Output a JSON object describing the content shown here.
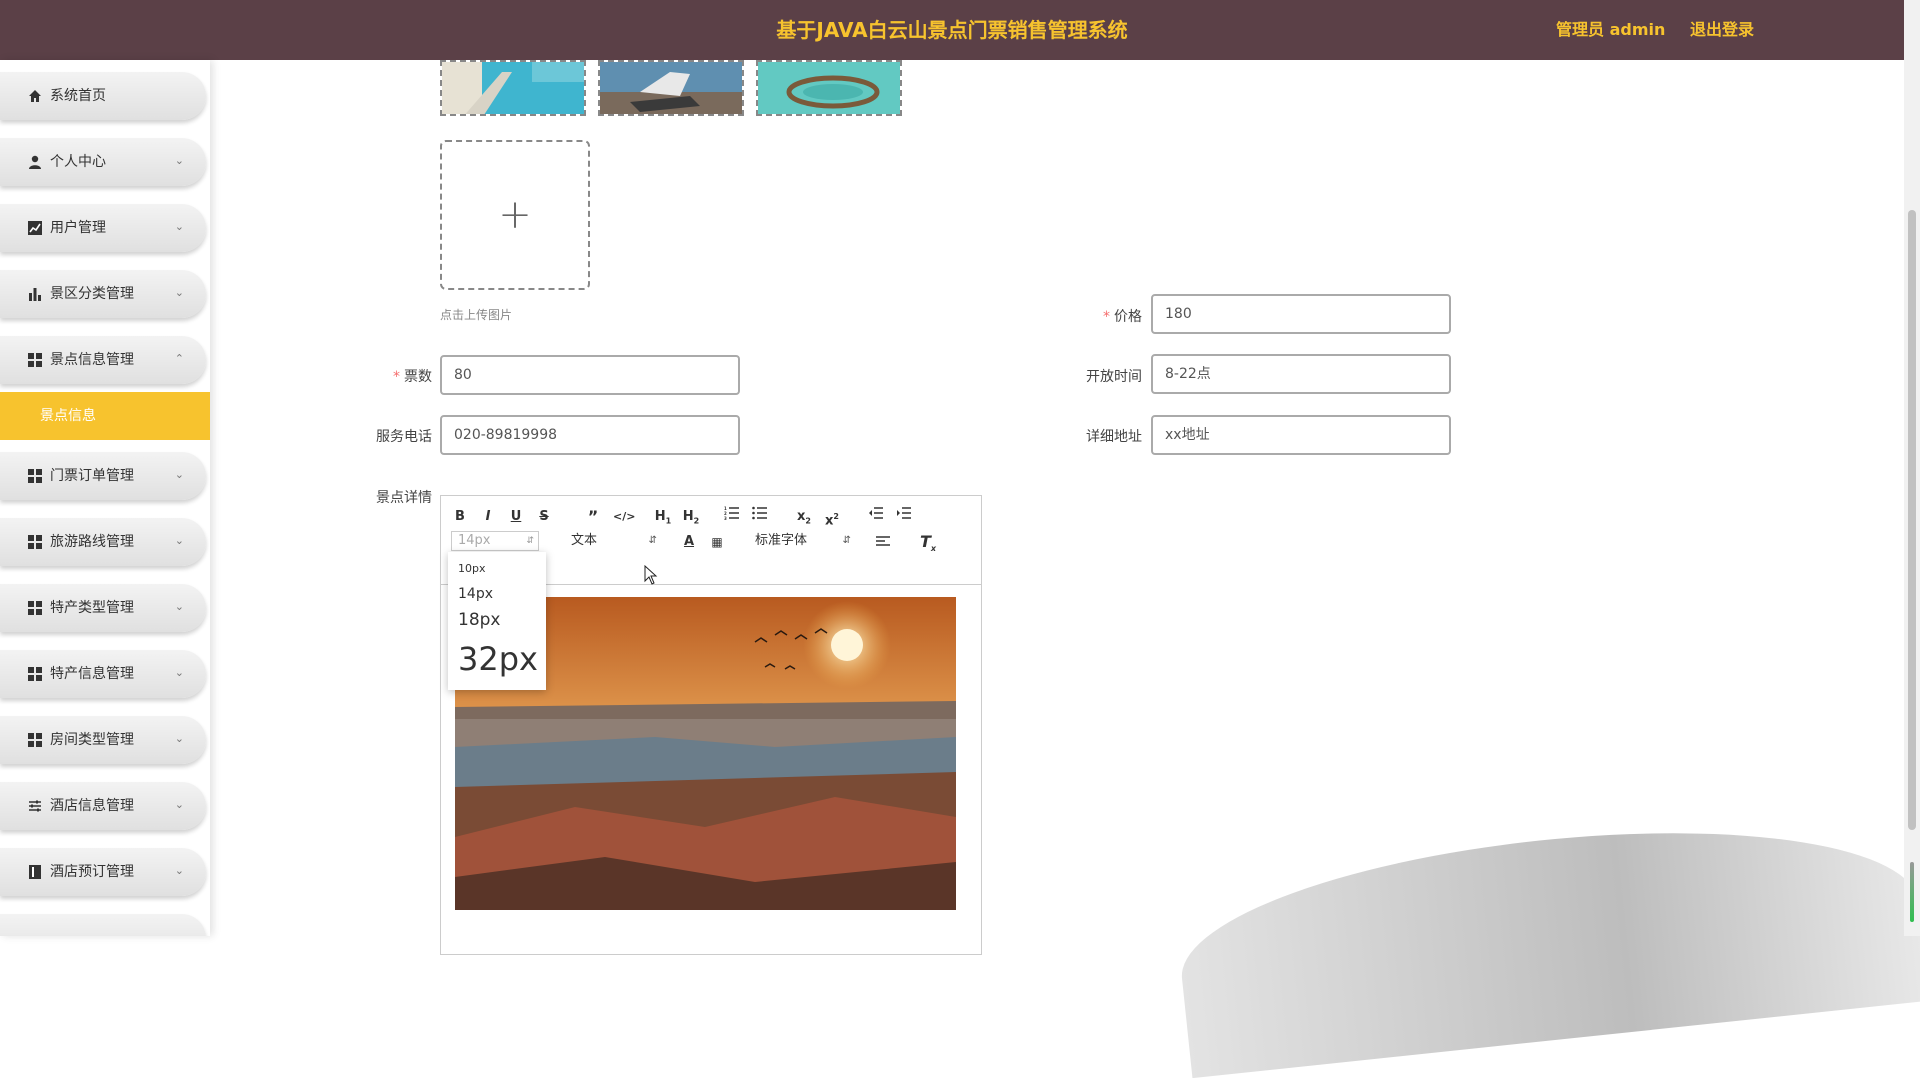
{
  "header": {
    "title": "基于JAVA白云山景点门票销售管理系统",
    "user_label": "管理员 admin",
    "logout_label": "退出登录"
  },
  "sidebar": {
    "items": [
      {
        "label": "系统首页",
        "icon": "home-icon"
      },
      {
        "label": "个人中心",
        "icon": "user-icon"
      },
      {
        "label": "用户管理",
        "icon": "chart-icon"
      },
      {
        "label": "景区分类管理",
        "icon": "bar-chart-icon"
      },
      {
        "label": "景点信息管理",
        "icon": "grid-icon"
      },
      {
        "label": "门票订单管理",
        "icon": "grid-icon"
      },
      {
        "label": "旅游路线管理",
        "icon": "grid-icon"
      },
      {
        "label": "特产类型管理",
        "icon": "grid-icon"
      },
      {
        "label": "特产信息管理",
        "icon": "grid-icon"
      },
      {
        "label": "房间类型管理",
        "icon": "grid-icon"
      },
      {
        "label": "酒店信息管理",
        "icon": "sliders-icon"
      },
      {
        "label": "酒店预订管理",
        "icon": "book-icon"
      }
    ],
    "active_submenu": "景点信息"
  },
  "form": {
    "upload_hint": "点击上传图片",
    "price": {
      "label": "价格",
      "value": "180"
    },
    "tickets": {
      "label": "票数",
      "value": "80"
    },
    "open_time": {
      "label": "开放时间",
      "value": "8-22点"
    },
    "phone": {
      "label": "服务电话",
      "value": "020-89819998"
    },
    "address": {
      "label": "详细地址",
      "value": "xx地址"
    },
    "detail_label": "景点详情"
  },
  "editor": {
    "size_select": "14px",
    "header_select": "文本",
    "font_select": "标准字体",
    "size_options": [
      "10px",
      "14px",
      "18px",
      "32px"
    ]
  },
  "colors": {
    "header_bg": "#5b4047",
    "accent": "#f7c32e",
    "required": "#f56c6c"
  }
}
